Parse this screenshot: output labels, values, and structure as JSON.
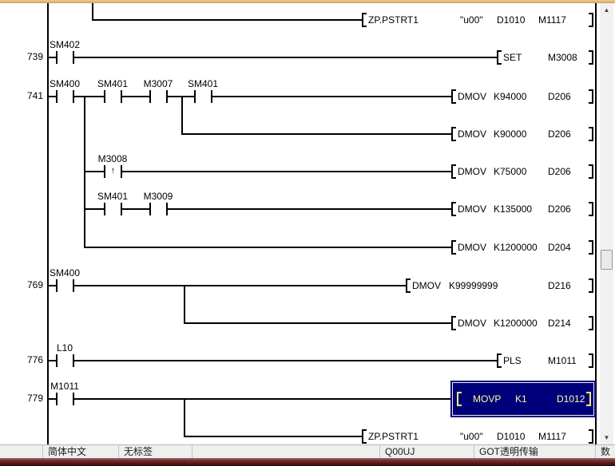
{
  "app": "ladder-editor",
  "colors": {
    "selection_bg": "#00007b",
    "selection_inner_border": "#ededed",
    "selection_text": "#ffffa0",
    "top_bar": "#dcae7a",
    "bottom_bar": "#5c1c1c",
    "wire": "#000000",
    "status_bg": "#eef0ee"
  },
  "scrollbar": {
    "up_icon": "▲",
    "down_icon": "▼"
  },
  "status": {
    "items": [
      {
        "label": ""
      },
      {
        "label": "简体中文"
      },
      {
        "label": "无标签"
      },
      {
        "label": ""
      },
      {
        "label": "Q00UJ"
      },
      {
        "label": "GOT透明传输"
      },
      {
        "label": "数"
      }
    ]
  },
  "ladder": {
    "rungs": [
      {
        "id": "continuation-top",
        "step": "",
        "instr": {
          "name": "ZP.PSTRT1",
          "ops": [
            "\"u00\"",
            "D1010",
            "M1117"
          ]
        }
      },
      {
        "id": "rung-739",
        "step": "739",
        "contacts": [
          {
            "label": "SM402"
          }
        ],
        "instr": {
          "name": "SET",
          "ops": [
            "M3008"
          ]
        }
      },
      {
        "id": "rung-741",
        "step": "741",
        "contacts": [
          {
            "label": "SM400"
          },
          {
            "label": "SM401"
          },
          {
            "label": "M3007"
          },
          {
            "label": "SM401"
          }
        ],
        "instr": {
          "name": "DMOV",
          "ops": [
            "K94000",
            "D206"
          ]
        }
      },
      {
        "id": "rung-741-branch2",
        "step": "",
        "instr": {
          "name": "DMOV",
          "ops": [
            "K90000",
            "D206"
          ]
        }
      },
      {
        "id": "rung-741-branch3",
        "step": "",
        "contacts": [
          {
            "label": "M3008",
            "edge": "↑"
          }
        ],
        "instr": {
          "name": "DMOV",
          "ops": [
            "K75000",
            "D206"
          ]
        }
      },
      {
        "id": "rung-741-branch4",
        "step": "",
        "contacts": [
          {
            "label": "SM401"
          },
          {
            "label": "M3009"
          }
        ],
        "instr": {
          "name": "DMOV",
          "ops": [
            "K135000",
            "D206"
          ]
        }
      },
      {
        "id": "rung-741-branch5",
        "step": "",
        "instr": {
          "name": "DMOV",
          "ops": [
            "K1200000",
            "D204"
          ]
        }
      },
      {
        "id": "rung-769",
        "step": "769",
        "contacts": [
          {
            "label": "SM400"
          }
        ],
        "instr": {
          "name": "DMOV",
          "ops": [
            "K99999999",
            "D216"
          ]
        }
      },
      {
        "id": "rung-769-branch2",
        "step": "",
        "instr": {
          "name": "DMOV",
          "ops": [
            "K1200000",
            "D214"
          ]
        }
      },
      {
        "id": "rung-776",
        "step": "776",
        "contacts": [
          {
            "label": "L10"
          }
        ],
        "instr": {
          "name": "PLS",
          "ops": [
            "M1011"
          ]
        }
      },
      {
        "id": "rung-779",
        "step": "779",
        "selected": true,
        "contacts": [
          {
            "label": "M1011"
          }
        ],
        "instr": {
          "name": "MOVP",
          "ops": [
            "K1",
            "D1012"
          ]
        }
      },
      {
        "id": "rung-779-branch2",
        "step": "",
        "instr": {
          "name": "ZP.PSTRT1",
          "ops": [
            "\"u00\"",
            "D1010",
            "M1117"
          ]
        }
      }
    ]
  }
}
